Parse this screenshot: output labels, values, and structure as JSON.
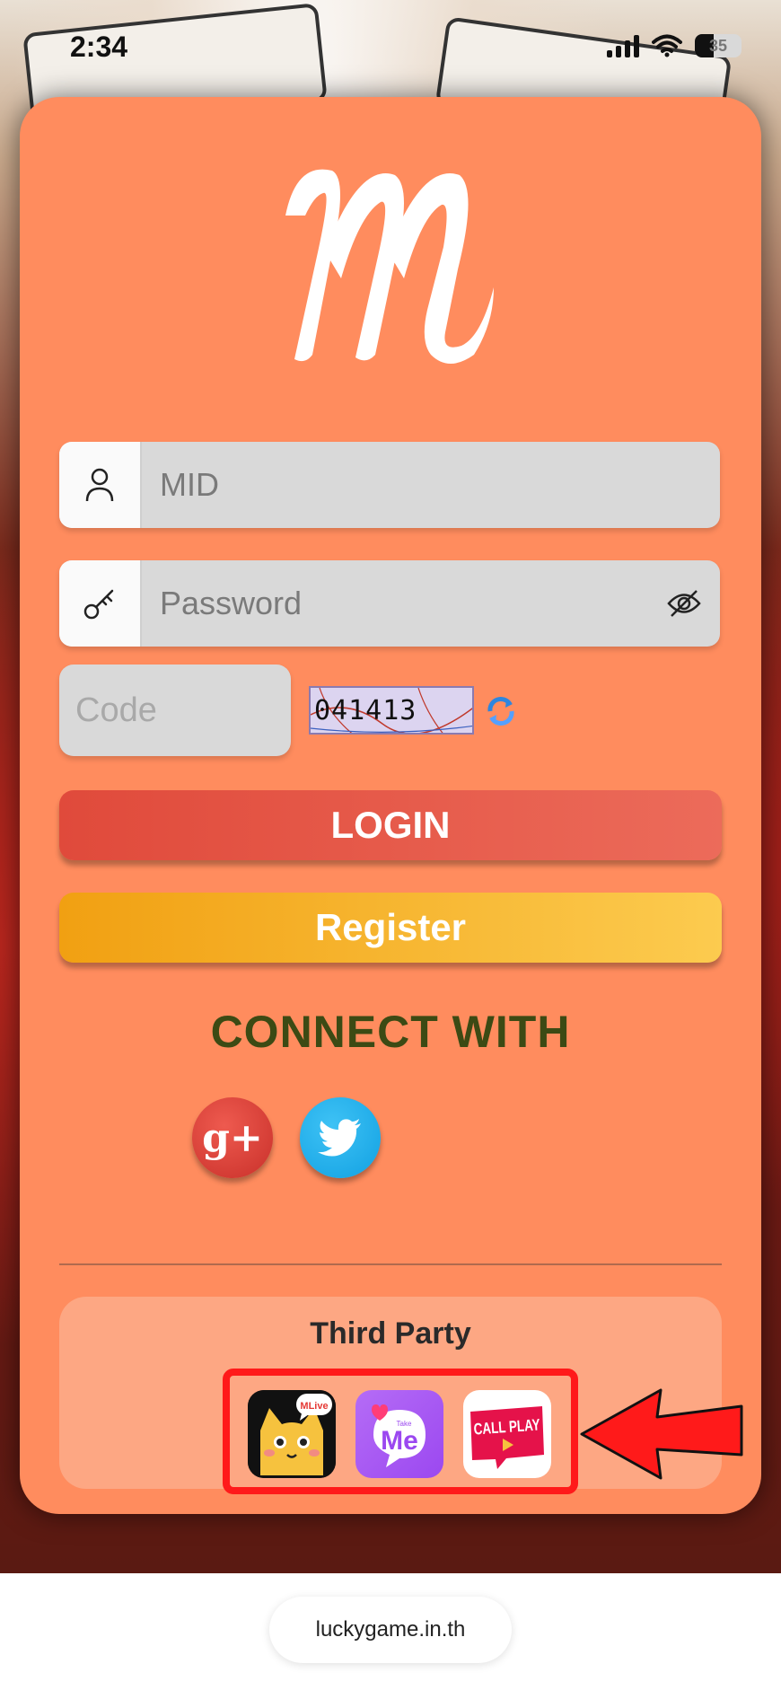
{
  "status_bar": {
    "time": "2:34",
    "battery": "35"
  },
  "form": {
    "mid_placeholder": "MID",
    "password_placeholder": "Password",
    "code_placeholder": "Code",
    "captcha_value": "041413"
  },
  "buttons": {
    "login": "LOGIN",
    "register": "Register"
  },
  "connect": {
    "title": "CONNECT WITH",
    "gplus_label": "g+"
  },
  "third_party": {
    "title": "Third Party",
    "apps": [
      {
        "name": "mlive-app-icon",
        "label": "MLive"
      },
      {
        "name": "takeme-app-icon",
        "label": "Me",
        "sublabel": "Take"
      },
      {
        "name": "callplay-app-icon",
        "label": "CALL PLAY"
      }
    ]
  },
  "browser": {
    "url": "luckygame.in.th"
  },
  "colors": {
    "panel": "#ff8c5e",
    "login": "#e04a3b",
    "register": "#f1a012",
    "connect_text": "#3c4a14",
    "highlight": "#ff1a1a"
  }
}
